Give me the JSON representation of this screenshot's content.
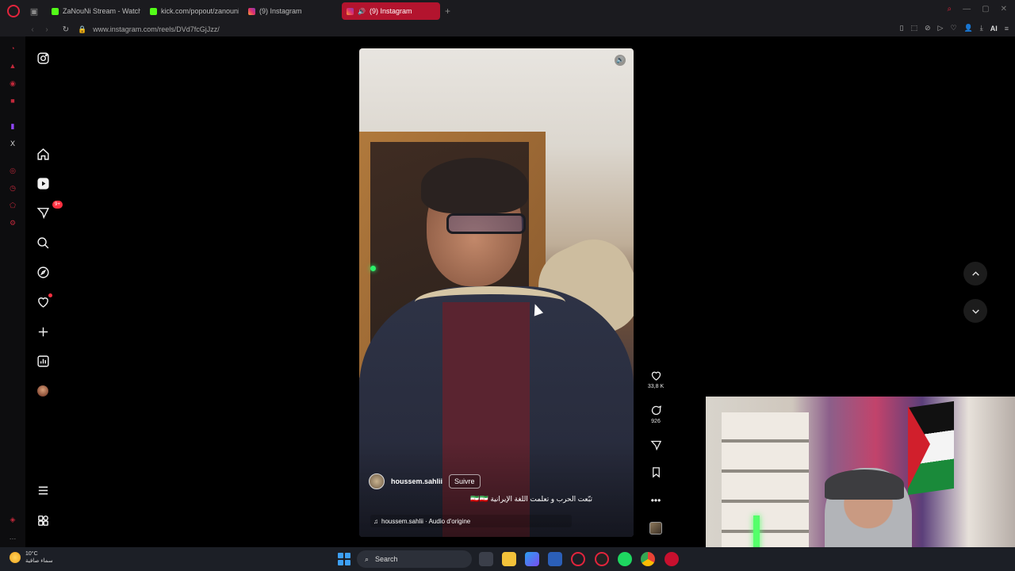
{
  "browser": {
    "tabs": [
      {
        "label": "ZaNouNi Stream - Watch L",
        "favicon": "kick-icon",
        "active": false
      },
      {
        "label": "kick.com/popout/zanouni",
        "favicon": "kick-icon",
        "active": false
      },
      {
        "label": "(9) Instagram",
        "favicon": "instagram-icon",
        "active": false
      },
      {
        "label": "(9) Instagram",
        "favicon": "instagram-icon",
        "active": true
      }
    ],
    "new_tab": "+",
    "url": "www.instagram.com/reels/DVd7fcGjJzz/",
    "ai_label": "AI"
  },
  "instagram": {
    "nav_items": [
      "instagram-logo",
      "home",
      "reels",
      "messages",
      "search",
      "explore",
      "notifications",
      "create",
      "dashboard",
      "profile"
    ],
    "messages_badge": "9+",
    "reel": {
      "author": "houssem.sahlii",
      "follow_label": "Suivre",
      "caption": "تبّعت الحرب و تعلمت اللغة الإيرانية 🇮🇷🇮🇷",
      "audio": "houssem.sahlii · Audio d'origine",
      "likes": "33,8 K",
      "comments": "926"
    }
  },
  "taskbar": {
    "temperature": "10°C",
    "weather_desc": "سماء صافية",
    "search_label": "Search"
  },
  "colors": {
    "accent_opera": "#e2243c",
    "active_tab": "#b3142e",
    "badge": "#ff3040"
  }
}
